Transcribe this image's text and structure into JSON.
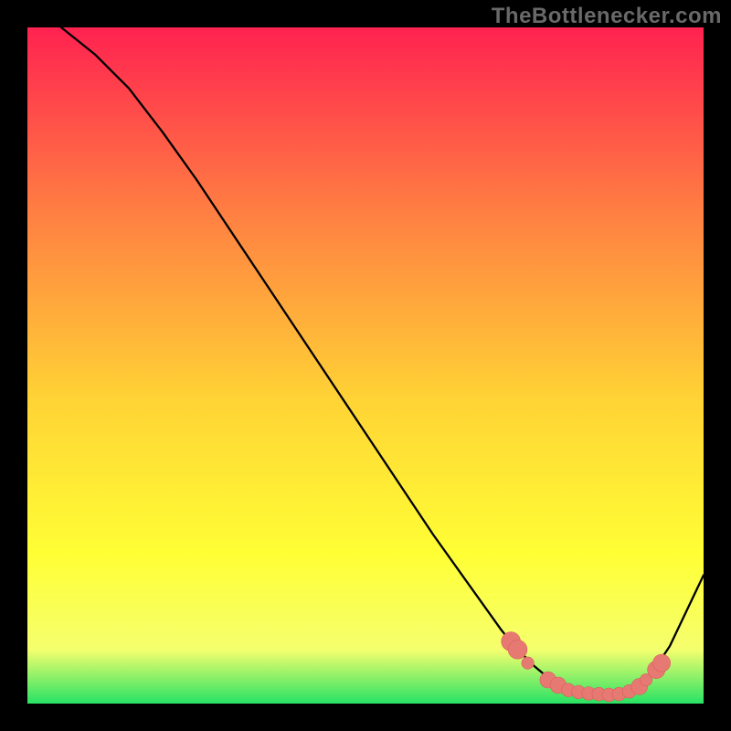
{
  "attribution": "TheBottlenecker.com",
  "colors": {
    "background": "#000000",
    "gradient_top": "#ff2250",
    "gradient_mid_upper": "#ff8142",
    "gradient_mid": "#ffd335",
    "gradient_mid_lower": "#ffff35",
    "gradient_low": "#f5ff6e",
    "gradient_bottom": "#28e264",
    "curve_stroke": "#000000",
    "marker_fill": "#e77973",
    "marker_stroke": "#d85f5b"
  },
  "chart_data": {
    "type": "line",
    "title": "",
    "xlabel": "",
    "ylabel": "",
    "xlim": [
      0,
      100
    ],
    "ylim": [
      0,
      100
    ],
    "grid": false,
    "series": [
      {
        "name": "bottleneck-curve",
        "x": [
          5,
          10,
          15,
          20,
          25,
          30,
          35,
          40,
          45,
          50,
          55,
          60,
          65,
          70,
          72,
          75,
          78,
          80,
          82,
          84,
          86,
          88,
          90,
          92,
          95,
          100
        ],
        "y": [
          100,
          96,
          91,
          84.5,
          77.5,
          70,
          62.5,
          55,
          47.5,
          40,
          32.5,
          25,
          18,
          11,
          8.5,
          5.5,
          3,
          2,
          1.5,
          1.3,
          1.3,
          1.5,
          2.2,
          4,
          8.5,
          19
        ]
      }
    ],
    "markers": [
      {
        "x": 71.5,
        "y": 9.2,
        "r": 1.4
      },
      {
        "x": 72.5,
        "y": 8,
        "r": 1.4
      },
      {
        "x": 74,
        "y": 6,
        "r": 0.9
      },
      {
        "x": 77,
        "y": 3.5,
        "r": 1.2
      },
      {
        "x": 78.5,
        "y": 2.7,
        "r": 1.2
      },
      {
        "x": 80,
        "y": 2,
        "r": 1.0
      },
      {
        "x": 81.5,
        "y": 1.7,
        "r": 1.0
      },
      {
        "x": 83,
        "y": 1.5,
        "r": 1.0
      },
      {
        "x": 84.5,
        "y": 1.4,
        "r": 1.0
      },
      {
        "x": 86,
        "y": 1.3,
        "r": 1.0
      },
      {
        "x": 87.5,
        "y": 1.4,
        "r": 1.0
      },
      {
        "x": 89,
        "y": 1.8,
        "r": 1.0
      },
      {
        "x": 90.5,
        "y": 2.5,
        "r": 1.2
      },
      {
        "x": 91.5,
        "y": 3.5,
        "r": 0.9
      },
      {
        "x": 93,
        "y": 5,
        "r": 1.3
      },
      {
        "x": 93.8,
        "y": 6,
        "r": 1.3
      }
    ]
  }
}
